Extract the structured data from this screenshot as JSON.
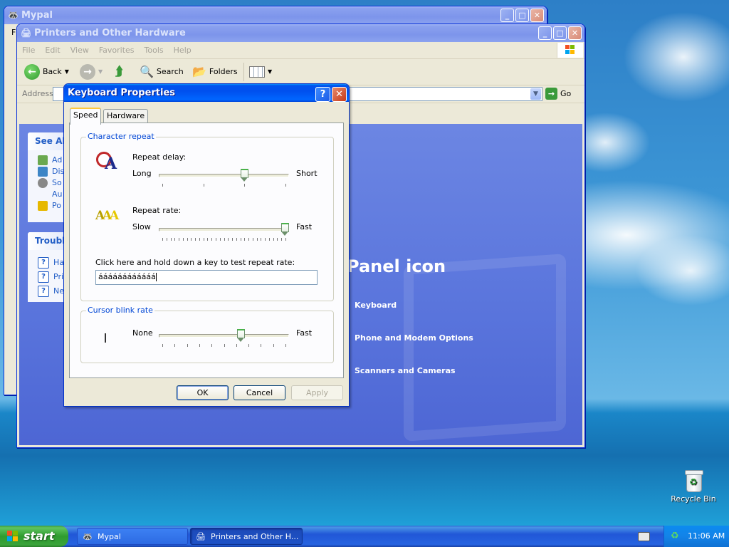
{
  "desktop": {
    "recycle_bin_label": "Recycle Bin"
  },
  "mypal_window": {
    "title": "Mypal",
    "menu_fragment": "F"
  },
  "printers_window": {
    "title": "Printers and Other Hardware",
    "menu": [
      "File",
      "Edit",
      "View",
      "Favorites",
      "Tools",
      "Help"
    ],
    "toolbar": {
      "back_label": "Back",
      "search_label": "Search",
      "folders_label": "Folders"
    },
    "address_label": "Address",
    "go_label": "Go",
    "see_also": {
      "header": "See Als",
      "items": [
        "Ad",
        "Dis",
        "So",
        "Au",
        "Po"
      ]
    },
    "troubleshooters": {
      "header": "Troubl",
      "items": [
        "Ha",
        "Prir",
        "Ne"
      ]
    },
    "section_title": "Panel icon",
    "task_links": [
      "Keyboard",
      "Phone and Modem Options",
      "Scanners and Cameras"
    ]
  },
  "keyboard_dialog": {
    "title": "Keyboard Properties",
    "help_btn": "?",
    "close_btn": "✕",
    "tabs": [
      "Speed",
      "Hardware"
    ],
    "active_tab": "Speed",
    "character_repeat": {
      "group_label": "Character repeat",
      "repeat_delay": {
        "label": "Repeat delay:",
        "min_label": "Long",
        "max_label": "Short",
        "value_fraction": 0.67
      },
      "repeat_rate": {
        "label": "Repeat rate:",
        "min_label": "Slow",
        "max_label": "Fast",
        "value_fraction": 1.0
      },
      "test_label": "Click here and hold down a key to test repeat rate:",
      "test_value": "áááááááááááá"
    },
    "cursor_blink": {
      "group_label": "Cursor blink rate",
      "min_label": "None",
      "max_label": "Fast",
      "value_fraction": 0.64
    },
    "buttons": {
      "ok": "OK",
      "cancel": "Cancel",
      "apply": "Apply"
    }
  },
  "taskbar": {
    "start_label": "start",
    "tasks": [
      {
        "label": "Mypal",
        "active": false
      },
      {
        "label": "Printers and Other H...",
        "active": true
      }
    ],
    "clock": "11:06 AM"
  },
  "colors": {
    "title_bar_blue": "#0053ee",
    "start_green": "#3aa33a",
    "content_blue": "#5a7edc",
    "group_label_blue": "#0046d5"
  }
}
